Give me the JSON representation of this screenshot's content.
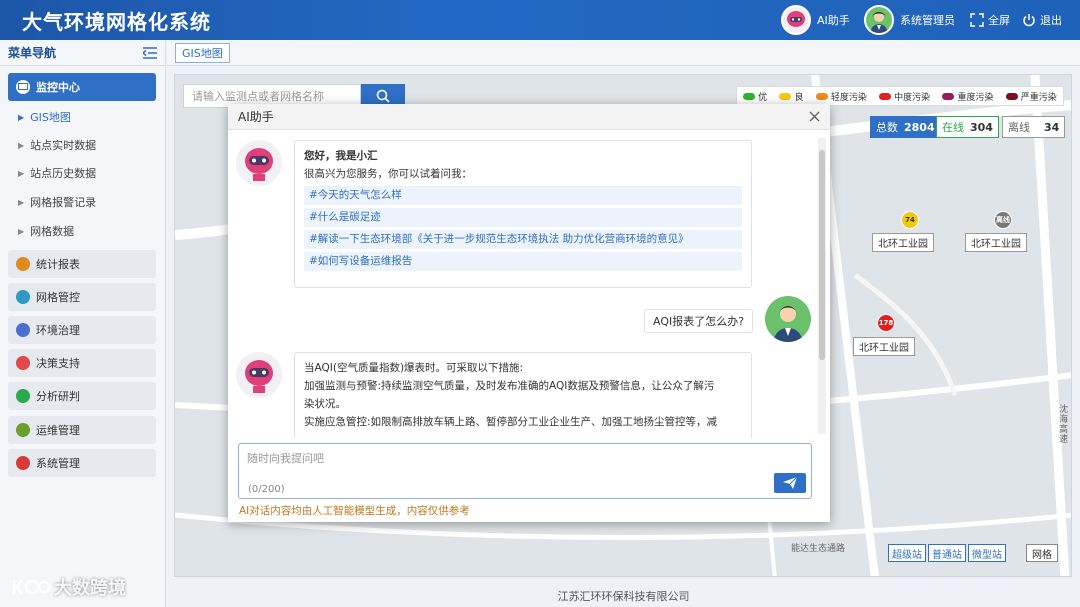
{
  "app": {
    "title": "大气环境网格化系统"
  },
  "header": {
    "ai_label": "AI助手",
    "user_label": "系统管理员",
    "fullscreen_label": "全屏",
    "logout_label": "退出"
  },
  "sidebar": {
    "title": "菜单导航",
    "monitor_center": "监控中心",
    "sub_items": [
      "GIS地图",
      "站点实时数据",
      "站点历史数据",
      "网格报警记录",
      "网格数据"
    ],
    "items": [
      "统计报表",
      "网格管控",
      "环境治理",
      "决策支持",
      "分析研判",
      "运维管理",
      "系统管理"
    ]
  },
  "tabs": {
    "active": "GIS地图"
  },
  "map": {
    "search_placeholder": "请输入监测点或者网格名称",
    "legend": [
      {
        "label": "优",
        "color": "#2bb52b"
      },
      {
        "label": "良",
        "color": "#f2c811"
      },
      {
        "label": "轻度污染",
        "color": "#f08a1c"
      },
      {
        "label": "中度污染",
        "color": "#e02020"
      },
      {
        "label": "重度污染",
        "color": "#9b1a5e"
      },
      {
        "label": "严重污染",
        "color": "#7a1020"
      }
    ],
    "stats": {
      "total_label": "总数",
      "total": "2804",
      "online_label": "在线",
      "online": "304",
      "offline_label": "离线",
      "offline": "34"
    },
    "labels": [
      "北环工业园",
      "北环工业园",
      "北环工业园"
    ],
    "pins": [
      "74",
      "离线",
      "178"
    ],
    "road_labels": [
      "沈海高速",
      "能达生态通路"
    ],
    "station_buttons": [
      "超级站",
      "普通站",
      "微型站"
    ],
    "grid_button": "网格"
  },
  "dialog": {
    "title": "AI助手",
    "greeting_title": "您好，我是小汇",
    "greeting_text": "很高兴为您服务，你可以试着问我：",
    "suggestions": [
      "#今天的天气怎么样",
      "#什么是碳足迹",
      "#解读一下生态环境部《关于进一步规范生态环境执法 助力优化营商环境的意见》",
      "#如何写设备运维报告"
    ],
    "user_question": "AQI报表了怎么办?",
    "answer_lines": [
      "当AQI(空气质量指数)爆表时。可采取以下措施:",
      "加强监测与预警:持续监测空气质量，及时发布准确的AQI数据及预警信息，让公众了解污",
      "染状况。",
      "实施应急管控:如限制高排放车辆上路、暂停部分工业企业生产、加强工地扬尘管控等，减"
    ],
    "input_placeholder": "随时向我提问吧",
    "counter": "(0/200)",
    "disclaimer": "AI对话内容均由人工智能模型生成，内容仅供参考"
  },
  "footer": {
    "company": "江苏汇环环保科技有限公司"
  },
  "watermark": {
    "text": "大数跨境"
  }
}
